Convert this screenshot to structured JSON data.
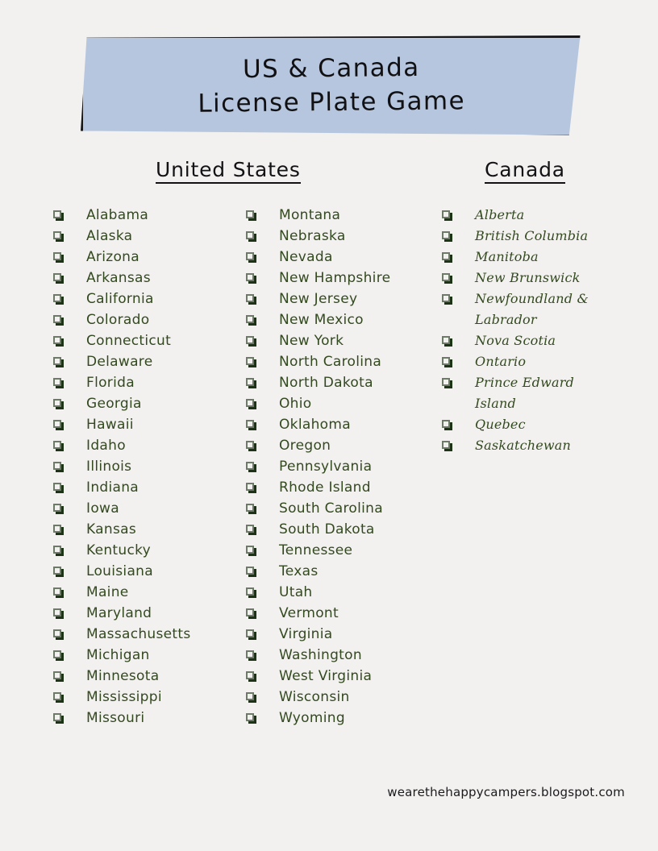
{
  "page": {
    "background_color": "#f2f1ef",
    "footer_text": "wearethehappycampers.blogspot.com"
  },
  "banner": {
    "fill_color": "#b6c6de",
    "border_color": "#17171a",
    "title_line_1": "US & Canada",
    "title_line_2": "License Plate Game"
  },
  "sections": {
    "united_states": {
      "heading": "United States",
      "text_color": "#33491f",
      "column_1": [
        "Alabama",
        "Alaska",
        "Arizona",
        "Arkansas",
        "California",
        "Colorado",
        "Connecticut",
        "Delaware",
        "Florida",
        "Georgia",
        "Hawaii",
        "Idaho",
        "Illinois",
        "Indiana",
        "Iowa",
        "Kansas",
        "Kentucky",
        "Louisiana",
        "Maine",
        "Maryland",
        "Massachusetts",
        "Michigan",
        "Minnesota",
        "Mississippi",
        "Missouri"
      ],
      "column_2": [
        "Montana",
        "Nebraska",
        "Nevada",
        "New Hampshire",
        "New Jersey",
        "New Mexico",
        "New York",
        "North Carolina",
        "North Dakota",
        "Ohio",
        "Oklahoma",
        "Oregon",
        "Pennsylvania",
        "Rhode Island",
        "South Carolina",
        "South Dakota",
        "Tennessee",
        "Texas",
        "Utah",
        "Vermont",
        "Virginia",
        "Washington",
        "West Virginia",
        "Wisconsin",
        "Wyoming"
      ]
    },
    "canada": {
      "heading": "Canada",
      "text_color": "#33491f",
      "items": [
        "Alberta",
        "British Columbia",
        "Manitoba",
        "New Brunswick",
        "Newfoundland &\nLabrador",
        "Nova Scotia",
        "Ontario",
        "Prince Edward\nIsland",
        "Quebec",
        "Saskatchewan"
      ]
    }
  }
}
